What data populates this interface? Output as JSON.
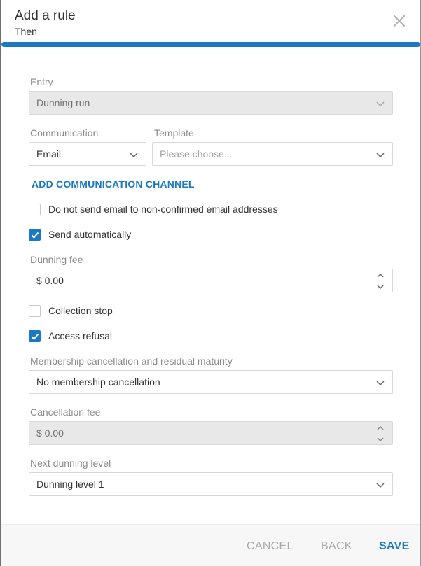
{
  "dialog": {
    "title": "Add a rule",
    "subtitle": "Then",
    "progress_percent": 100,
    "accent_color": "#1b79c4"
  },
  "entry": {
    "label": "Entry",
    "value": "Dunning run"
  },
  "communication": {
    "label": "Communication",
    "value": "Email"
  },
  "template": {
    "label": "Template",
    "placeholder": "Please choose..."
  },
  "add_channel_label": "ADD COMMUNICATION CHANNEL",
  "checkboxes": {
    "no_nonconfirmed": {
      "label": "Do not send email to non-confirmed email addresses",
      "checked": false
    },
    "send_auto": {
      "label": "Send automatically",
      "checked": true
    },
    "collection_stop": {
      "label": "Collection stop",
      "checked": false
    },
    "access_refusal": {
      "label": "Access refusal",
      "checked": true
    }
  },
  "dunning_fee": {
    "label": "Dunning fee",
    "value": "$ 0.00"
  },
  "membership": {
    "label": "Membership cancellation and residual maturity",
    "value": "No membership cancellation"
  },
  "cancellation_fee": {
    "label": "Cancellation fee",
    "value": "$ 0.00"
  },
  "next_level": {
    "label": "Next dunning level",
    "value": "Dunning level 1"
  },
  "footer": {
    "cancel": "CANCEL",
    "back": "BACK",
    "save": "SAVE"
  }
}
